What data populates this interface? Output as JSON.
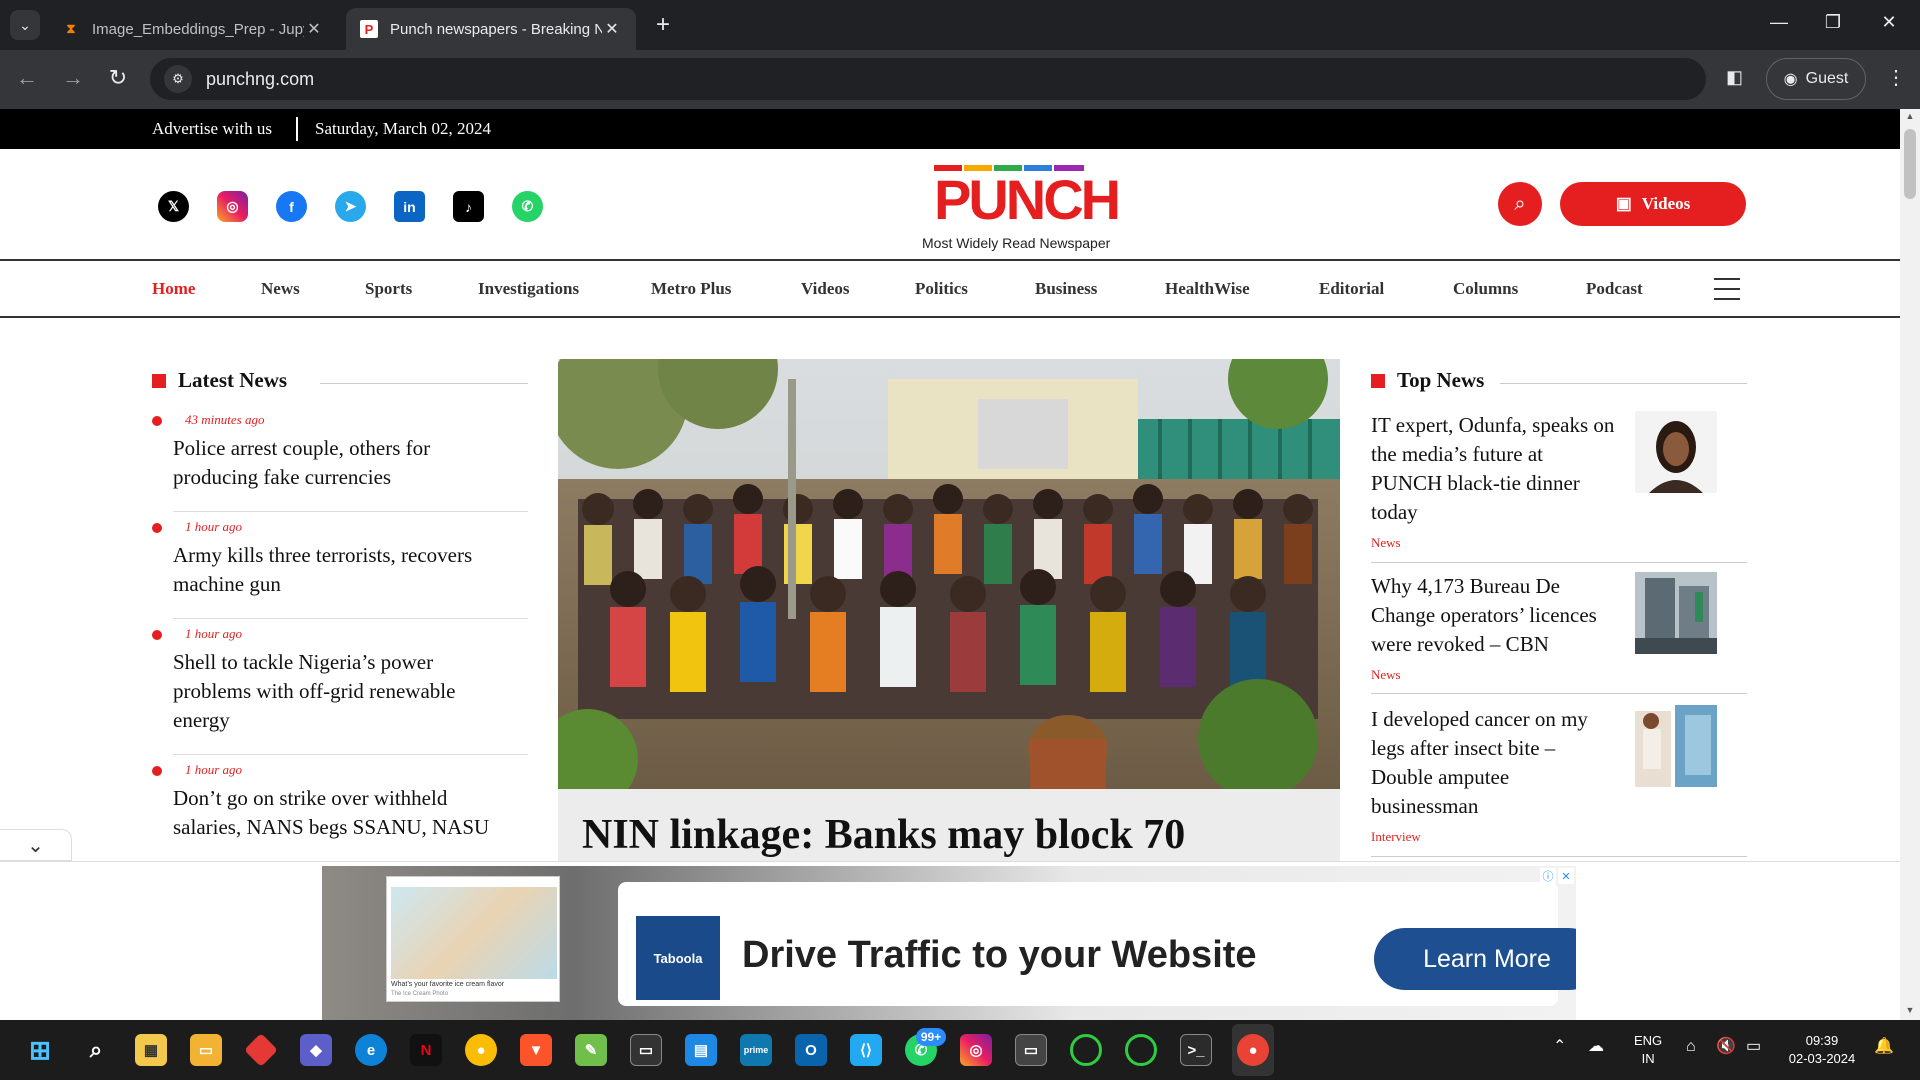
{
  "browser": {
    "tabs": [
      {
        "title": "Image_Embeddings_Prep - Jupyter",
        "icon": "hourglass-icon"
      },
      {
        "title": "Punch newspapers - Breaking News",
        "icon": "punch-favicon"
      }
    ],
    "url": "punchng.com",
    "profile_label": "Guest"
  },
  "topbar": {
    "advertise": "Advertise with us",
    "date": "Saturday, March 02, 2024"
  },
  "header": {
    "logo_text": "PUNCH",
    "tagline": "Most Widely Read Newspaper",
    "videos_label": "Videos",
    "socials": [
      "x-icon",
      "instagram-icon",
      "facebook-icon",
      "telegram-icon",
      "linkedin-icon",
      "tiktok-icon",
      "whatsapp-icon"
    ]
  },
  "nav": {
    "items": [
      "Home",
      "News",
      "Sports",
      "Investigations",
      "Metro Plus",
      "Videos",
      "Politics",
      "Business",
      "HealthWise",
      "Editorial",
      "Columns",
      "Podcast"
    ]
  },
  "latest_news": {
    "title": "Latest News",
    "items": [
      {
        "time": "43 minutes ago",
        "headline_l1": "Police arrest couple, others for",
        "headline_l2": "producing fake currencies",
        "headline_l3": ""
      },
      {
        "time": "1 hour ago",
        "headline_l1": "Army kills three terrorists, recovers",
        "headline_l2": "machine gun",
        "headline_l3": ""
      },
      {
        "time": "1 hour ago",
        "headline_l1": "Shell to tackle Nigeria’s power",
        "headline_l2": "problems with off-grid renewable",
        "headline_l3": "energy"
      },
      {
        "time": "1 hour ago",
        "headline_l1": "Don’t go on strike over withheld",
        "headline_l2": "salaries, NANS begs SSANU, NASU",
        "headline_l3": ""
      }
    ]
  },
  "hero": {
    "headline": "NIN linkage: Banks may block 70"
  },
  "top_news": {
    "title": "Top News",
    "items": [
      {
        "headline_l1": "IT expert, Odunfa, speaks on",
        "headline_l2": "the media’s future at",
        "headline_l3": "PUNCH black-tie dinner",
        "headline_l4": "today",
        "category": "News"
      },
      {
        "headline_l1": "Why 4,173 Bureau De",
        "headline_l2": "Change operators’ licences",
        "headline_l3": "were revoked – CBN",
        "headline_l4": "",
        "category": "News"
      },
      {
        "headline_l1": "I developed cancer on my",
        "headline_l2": "legs after insect bite –",
        "headline_l3": "Double amputee",
        "headline_l4": "businessman",
        "category": "Interview"
      }
    ]
  },
  "ad": {
    "card_caption": "What’s your favorite ice cream flavor",
    "card_source": "The Ice Cream Photo",
    "brand": "Taboola",
    "headline": "Drive Traffic to your Website",
    "cta": "Learn More"
  },
  "taskbar": {
    "whatsapp_badge": "99+",
    "lang_l1": "ENG",
    "lang_l2": "IN",
    "time": "09:39",
    "date": "02-03-2024"
  },
  "colors": {
    "brand_red": "#e51f1f",
    "chrome_dark": "#202124",
    "chrome_toolbar": "#35363a",
    "taboola_blue": "#1d4f91"
  }
}
